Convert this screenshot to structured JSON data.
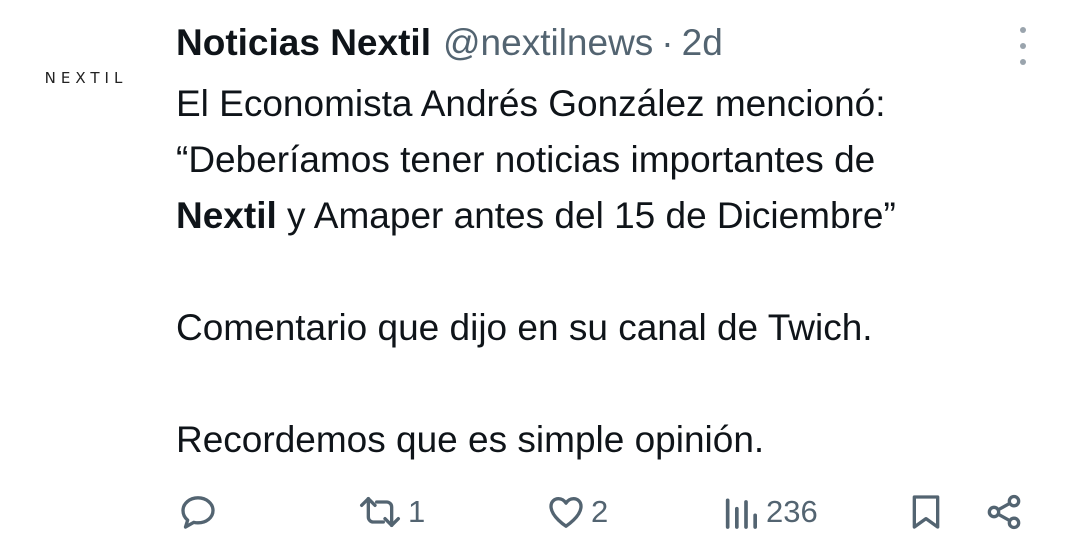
{
  "avatar": {
    "logo_text": "NEXTIL"
  },
  "author": {
    "name": "Noticias Nextil",
    "handle": "@nextilnews",
    "separator": "·",
    "time": "2d"
  },
  "tweet": {
    "line1": "El Economista Andrés González mencionó:",
    "line2": "“Deberíamos tener noticias importantes de",
    "line3_bold": "Nextil",
    "line3_rest": " y Amaper antes del 15 de Diciembre”",
    "para2": "Comentario que dijo en su canal de Twich.",
    "para3": "Recordemos que es simple opinión."
  },
  "actions": {
    "reply_count": "",
    "retweet_count": "1",
    "like_count": "2",
    "views_count": "236"
  },
  "icons": {
    "reply": "reply-icon",
    "retweet": "retweet-icon",
    "like": "heart-icon",
    "views": "views-icon",
    "bookmark": "bookmark-icon",
    "share": "share-icon",
    "more": "more-vertical-icon"
  },
  "colors": {
    "text": "#0f1419",
    "secondary": "#536471"
  }
}
